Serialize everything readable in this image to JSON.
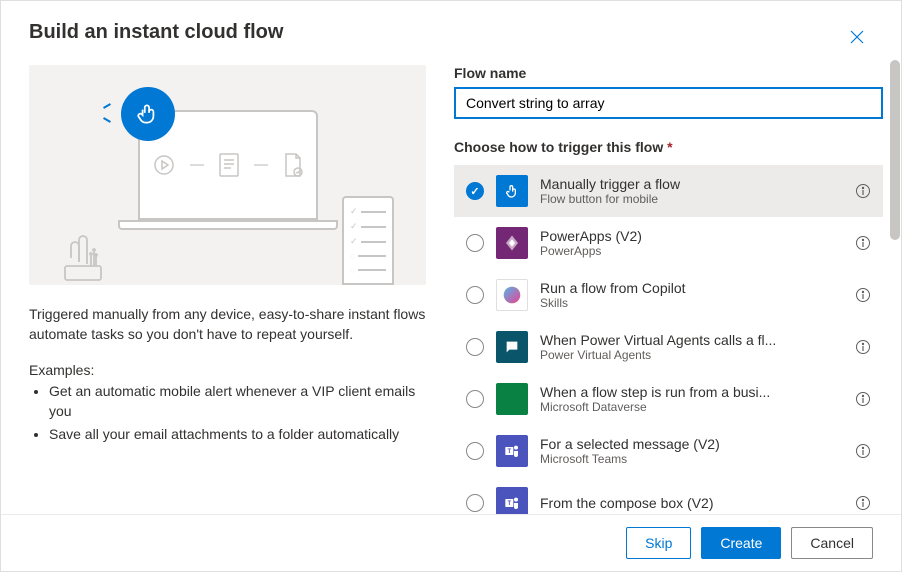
{
  "dialog": {
    "title": "Build an instant cloud flow",
    "close_label": "Close"
  },
  "left": {
    "description": "Triggered manually from any device, easy-to-share instant flows automate tasks so you don't have to repeat yourself.",
    "examples_label": "Examples:",
    "examples": [
      "Get an automatic mobile alert whenever a VIP client emails you",
      "Save all your email attachments to a folder automatically"
    ]
  },
  "right": {
    "flow_name_label": "Flow name",
    "flow_name_value": "Convert string to array",
    "trigger_label": "Choose how to trigger this flow",
    "triggers": [
      {
        "title": "Manually trigger a flow",
        "subtitle": "Flow button for mobile",
        "selected": true,
        "color": "#0078d4",
        "icon": "touch"
      },
      {
        "title": "PowerApps (V2)",
        "subtitle": "PowerApps",
        "selected": false,
        "color": "#742774",
        "icon": "powerapps"
      },
      {
        "title": "Run a flow from Copilot",
        "subtitle": "Skills",
        "selected": false,
        "color": "#ffffff",
        "icon": "copilot"
      },
      {
        "title": "When Power Virtual Agents calls a fl...",
        "subtitle": "Power Virtual Agents",
        "selected": false,
        "color": "#0b556a",
        "icon": "chat"
      },
      {
        "title": "When a flow step is run from a busi...",
        "subtitle": "Microsoft Dataverse",
        "selected": false,
        "color": "#088142",
        "icon": "dataverse"
      },
      {
        "title": "For a selected message (V2)",
        "subtitle": "Microsoft Teams",
        "selected": false,
        "color": "#4b53bc",
        "icon": "teams"
      },
      {
        "title": "From the compose box (V2)",
        "subtitle": "",
        "selected": false,
        "color": "#4b53bc",
        "icon": "teams"
      }
    ]
  },
  "footer": {
    "skip": "Skip",
    "create": "Create",
    "cancel": "Cancel"
  }
}
